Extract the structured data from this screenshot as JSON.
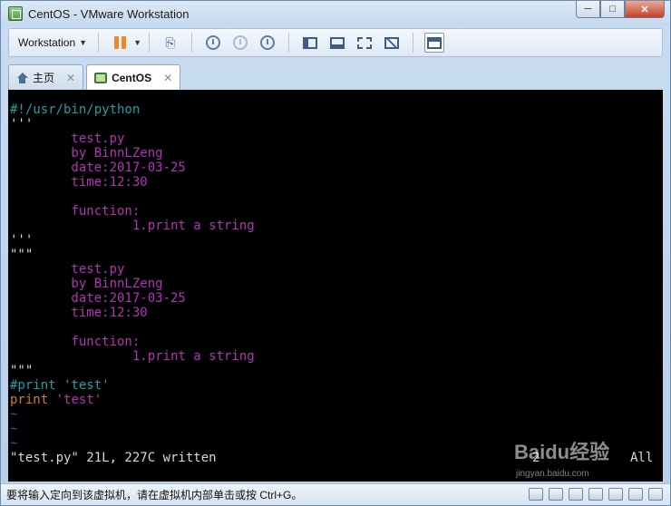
{
  "window": {
    "title": "CentOS - VMware Workstation"
  },
  "toolbar": {
    "menu_label": "Workstation",
    "icons": [
      "pause-icon",
      "send-ctrl-alt-del-icon",
      "snapshot-take-icon",
      "snapshot-revert-icon",
      "snapshot-manager-icon",
      "show-library-icon",
      "thumbnail-bar-icon",
      "full-screen-icon",
      "unity-icon",
      "console-view-icon"
    ]
  },
  "tabs": [
    {
      "label": "主页",
      "icon": "home-icon"
    },
    {
      "label": "CentOS",
      "icon": "vm-icon"
    }
  ],
  "console": {
    "lines": [
      {
        "text": "#!/usr/bin/python",
        "color": "#1aa0a8"
      },
      {
        "text": "'''",
        "color": "#d8d8d8"
      },
      {
        "text": "        test.py",
        "color": "#b531b5"
      },
      {
        "text": "        by BinnLZeng",
        "color": "#b531b5"
      },
      {
        "text": "        date:2017-03-25",
        "color": "#b531b5"
      },
      {
        "text": "        time:12:30",
        "color": "#b531b5"
      },
      {
        "text": "",
        "color": "#b531b5"
      },
      {
        "text": "        function:",
        "color": "#b531b5"
      },
      {
        "text": "                1.print a string",
        "color": "#b531b5"
      },
      {
        "text": "'''",
        "color": "#d8d8d8"
      },
      {
        "text": "\"\"\"",
        "color": "#d8d8d8"
      },
      {
        "text": "        test.py",
        "color": "#b531b5"
      },
      {
        "text": "        by BinnLZeng",
        "color": "#b531b5"
      },
      {
        "text": "        date:2017-03-25",
        "color": "#b531b5"
      },
      {
        "text": "        time:12:30",
        "color": "#b531b5"
      },
      {
        "text": "",
        "color": "#b531b5"
      },
      {
        "text": "        function:",
        "color": "#b531b5"
      },
      {
        "text": "                1.print a string",
        "color": "#b531b5"
      },
      {
        "text": "\"\"\"",
        "color": "#d8d8d8"
      },
      {
        "text": "#print 'test'",
        "color": "#1aa0a8"
      },
      {
        "text": "print",
        "color": "#d37a2c",
        "rest": " 'test'",
        "rest_color": "#b531b5"
      },
      {
        "text": "~",
        "color": "#2f4fd0"
      },
      {
        "text": "~",
        "color": "#2f4fd0"
      },
      {
        "text": "~",
        "color": "#2f4fd0"
      }
    ],
    "status_message": "\"test.py\" 21L, 227C written",
    "position": "2",
    "position_all": "All"
  },
  "watermark": {
    "text": "Baidu经验",
    "sub": "jingyan.baidu.com"
  },
  "statusbar": {
    "message": "要将输入定向到该虚拟机，请在虚拟机内部单击或按 Ctrl+G。",
    "icons": [
      "hard-disk-icon",
      "cd-drive-icon",
      "network-icon",
      "usb-icon",
      "printer-icon",
      "sound-icon",
      "message-icon"
    ]
  }
}
